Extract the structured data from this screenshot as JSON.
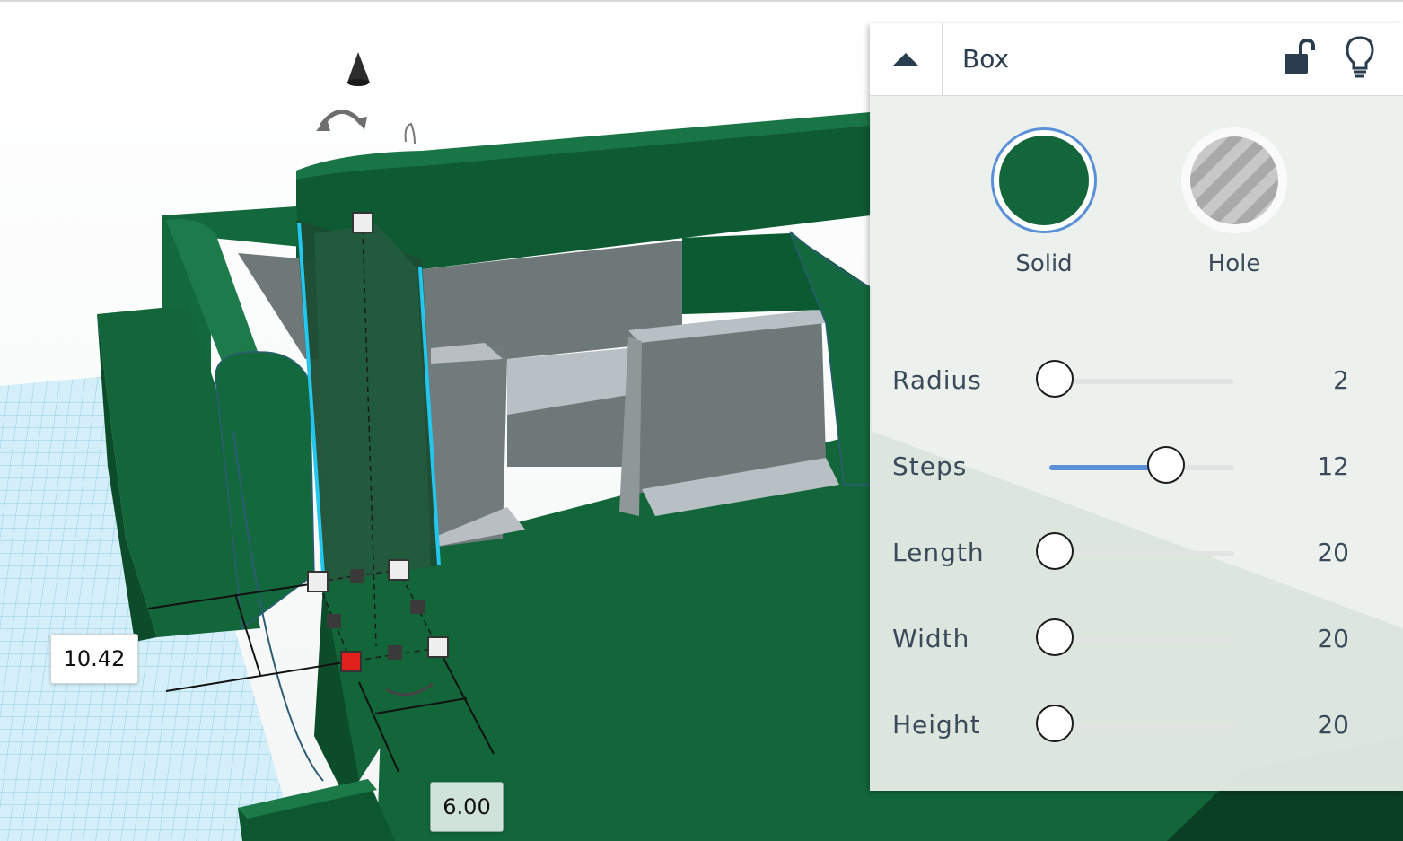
{
  "inspector": {
    "title": "Box",
    "collapse_icon": "chevron-up-icon",
    "lock_icon": "unlock-icon",
    "bulb_icon": "lightbulb-icon",
    "solid_label": "Solid",
    "hole_label": "Hole",
    "solid_color": "#12663a",
    "params": [
      {
        "label": "Radius",
        "value": "2",
        "fraction": 0.0
      },
      {
        "label": "Steps",
        "value": "12",
        "fraction": 0.6
      },
      {
        "label": "Length",
        "value": "20",
        "fraction": 0.0
      },
      {
        "label": "Width",
        "value": "20",
        "fraction": 0.0
      },
      {
        "label": "Height",
        "value": "20",
        "fraction": 0.0
      }
    ]
  },
  "dimensions": {
    "left_value": "10.42",
    "bottom_value": "6.00"
  },
  "colors": {
    "shape_green": "#12663a",
    "shape_dark_green": "#0b4a2a",
    "selection_cyan": "#22c6ee",
    "grid_blue": "#bfe6f4",
    "active_handle": "#e0201b"
  }
}
